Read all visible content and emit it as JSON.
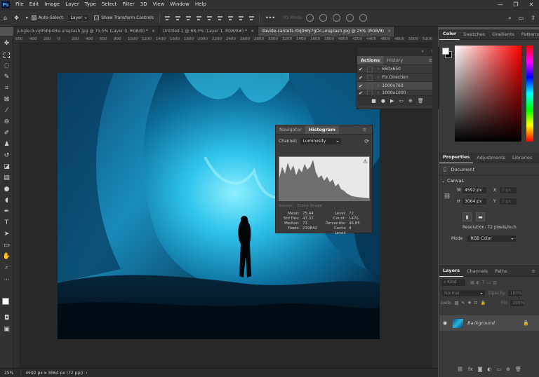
{
  "app": {
    "logo": "Ps"
  },
  "menu": [
    "File",
    "Edit",
    "Image",
    "Layer",
    "Type",
    "Select",
    "Filter",
    "3D",
    "View",
    "Window",
    "Help"
  ],
  "window_buttons": [
    "—",
    "❐",
    "✕"
  ],
  "options": {
    "auto_select_label": "Auto-Select:",
    "auto_select_value": "Layer",
    "transform_controls_label": "Show Transform Controls",
    "mode_3d": "3D Mode:"
  },
  "tabs": [
    {
      "label": "jungle-9-vg95Bp4He-unsplash.jpg @ 71,5% (Layer 0, RGB/8) *",
      "active": false
    },
    {
      "label": "Untitled-1 @ 68,3% (Layer 1, RGB/8#) *",
      "active": false
    },
    {
      "label": "davide-cantelli-r0q06hj7gOc-unsplash.jpg @ 25% (RGB/8)",
      "active": true
    }
  ],
  "ruler_ticks": [
    "600",
    "400",
    "200",
    "0",
    "200",
    "400",
    "600",
    "800",
    "1000",
    "1200",
    "1400",
    "1600",
    "1800",
    "2000",
    "2200",
    "2400",
    "2600",
    "2800",
    "3000",
    "3200",
    "3400",
    "3600",
    "3800",
    "4000",
    "4200",
    "4400",
    "4600",
    "4800",
    "5000",
    "5200"
  ],
  "status": {
    "zoom": "25%",
    "doc_info": "4592 px x 3064 px (72 ppi)"
  },
  "actions_panel": {
    "tabs": [
      "Actions",
      "History"
    ],
    "rows": [
      "650x650",
      "Fix Direction",
      "1000x760",
      "1000x1000"
    ]
  },
  "histogram_panel": {
    "tabs": [
      "Navigator",
      "Histogram"
    ],
    "channel_label": "Channel:",
    "channel_value": "Luminosity",
    "source_label": "Source:",
    "source_value": "Entire Image",
    "stats_left": [
      {
        "k": "Mean:",
        "v": "75,44"
      },
      {
        "k": "Std Dev:",
        "v": "47,37"
      },
      {
        "k": "Median:",
        "v": "73"
      },
      {
        "k": "Pixels:",
        "v": "219842"
      }
    ],
    "stats_right": [
      {
        "k": "Level:",
        "v": "72"
      },
      {
        "k": "Count:",
        "v": "1476"
      },
      {
        "k": "Percentile:",
        "v": "46,85"
      },
      {
        "k": "Cache Level:",
        "v": "4"
      }
    ]
  },
  "color_panel": {
    "tabs": [
      "Color",
      "Swatches",
      "Gradients",
      "Patterns"
    ],
    "fg": "#ffffff",
    "bg": "#000000",
    "hue": "#ff0000"
  },
  "properties_panel": {
    "tabs": [
      "Properties",
      "Adjustments",
      "Libraries"
    ],
    "document_label": "Document",
    "canvas_label": "Canvas",
    "w_label": "W",
    "w_value": "4592 px",
    "h_label": "H",
    "h_value": "3064 px",
    "x_label": "X",
    "x_value": "0 px",
    "y_label": "Y",
    "y_value": "0 px",
    "resolution": "Resolution: 72 pixels/inch",
    "mode_label": "Mode",
    "mode_value": "RGB Color"
  },
  "layers_panel": {
    "tabs": [
      "Layers",
      "Channels",
      "Paths"
    ],
    "kind": "Kind",
    "blend": "Normal",
    "opacity_label": "Opacity:",
    "opacity_value": "100%",
    "lock_label": "Lock:",
    "fill_label": "Fill:",
    "fill_value": "100%",
    "layer_name": "Background"
  }
}
